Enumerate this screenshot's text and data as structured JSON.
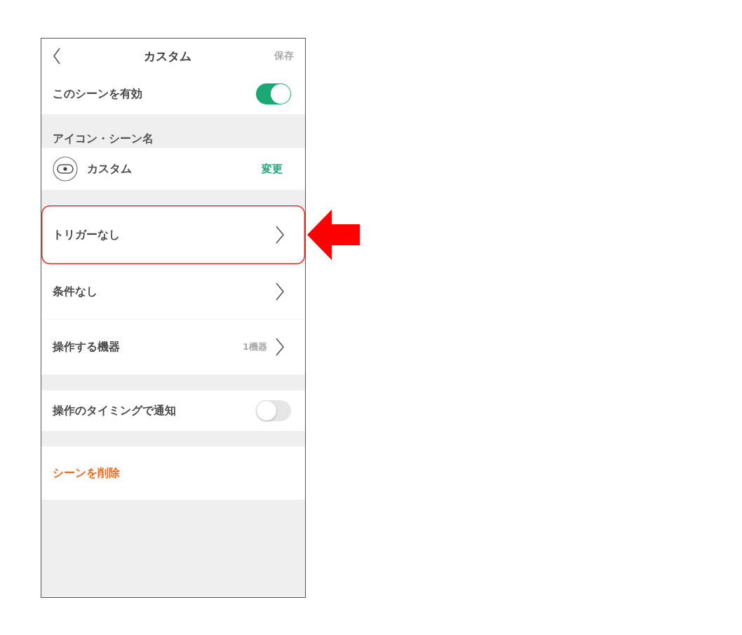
{
  "header": {
    "title": "カスタム",
    "action": "保存"
  },
  "rows": [
    {
      "kind": "toggle",
      "label": "このシーンを有効",
      "on": true
    },
    {
      "kind": "section",
      "label": "アイコン・シーン名"
    },
    {
      "kind": "icon",
      "label": "カスタム",
      "action": "変更"
    },
    {
      "kind": "gap"
    },
    {
      "kind": "nav",
      "label": "トリガーなし",
      "highlighted": true
    },
    {
      "kind": "nav",
      "label": "条件なし",
      "highlighted": false
    },
    {
      "kind": "nav",
      "label": "操作する機器",
      "value": "1機器",
      "highlighted": false
    },
    {
      "kind": "gap"
    },
    {
      "kind": "toggle",
      "label": "操作のタイミングで通知",
      "on": false
    },
    {
      "kind": "gap"
    },
    {
      "kind": "danger",
      "label": "シーンを削除"
    }
  ]
}
